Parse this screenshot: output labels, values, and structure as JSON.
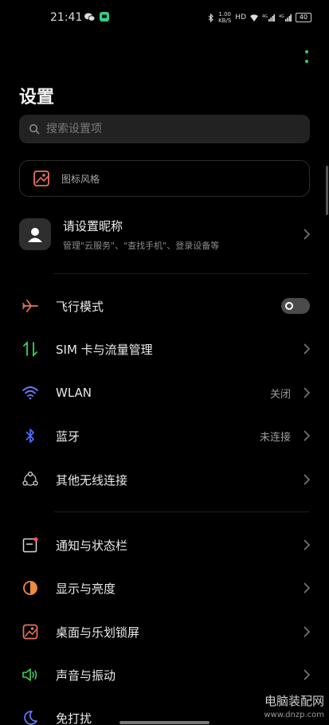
{
  "status_bar": {
    "time": "21:41",
    "speed_value": "1.00",
    "speed_unit": "KB/S",
    "hd_label": "HD",
    "battery": "40"
  },
  "page": {
    "title": "设置"
  },
  "search": {
    "placeholder": "搜索设置项"
  },
  "theme_card": {
    "label": "图标风格"
  },
  "account": {
    "name": "请设置昵称",
    "subtitle": "管理\"云服务\"、\"查找手机\"、登录设备等"
  },
  "menu": {
    "airplane": {
      "label": "飞行模式",
      "enabled": false
    },
    "sim": {
      "label": "SIM 卡与流量管理"
    },
    "wlan": {
      "label": "WLAN",
      "value": "关闭"
    },
    "bluetooth": {
      "label": "蓝牙",
      "value": "未连接"
    },
    "other_wireless": {
      "label": "其他无线连接"
    },
    "notifications": {
      "label": "通知与状态栏"
    },
    "display": {
      "label": "显示与亮度"
    },
    "desktop": {
      "label": "桌面与乐划锁屏"
    },
    "sound": {
      "label": "声音与振动"
    },
    "dnd": {
      "label": "免打扰"
    }
  },
  "watermark": {
    "title": "电脑装配网",
    "url": "www.dnzp.com"
  },
  "colors": {
    "accent_green": "#3ccf5a",
    "airplane_icon": "#e8735a",
    "sim_icon": "#3ccf5a",
    "wlan_icon": "#6a7bff",
    "bluetooth_icon": "#4f6cff",
    "display_icon": "#f08a3c",
    "sound_icon": "#3ccf5a",
    "dnd_icon": "#6a7bff"
  }
}
